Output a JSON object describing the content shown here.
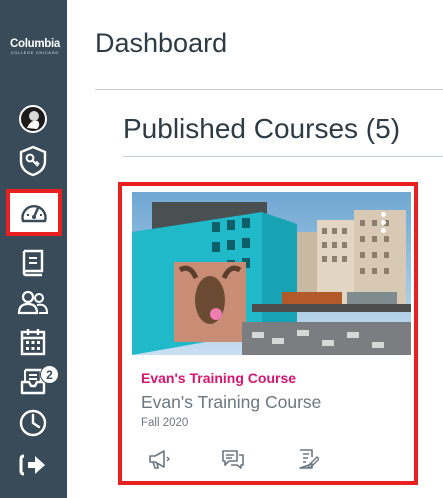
{
  "nav": {
    "brand": {
      "name": "Columbia",
      "subtitle": "COLLEGE CHICAGO"
    },
    "items": [
      {
        "name": "account",
        "icon": "account-avatar-icon"
      },
      {
        "name": "admin",
        "icon": "shield-key-icon"
      },
      {
        "name": "dashboard",
        "icon": "speedometer-icon",
        "active": true
      },
      {
        "name": "courses",
        "icon": "book-icon"
      },
      {
        "name": "groups",
        "icon": "people-icon"
      },
      {
        "name": "calendar",
        "icon": "calendar-icon"
      },
      {
        "name": "inbox",
        "icon": "inbox-icon",
        "badge": "2"
      },
      {
        "name": "history",
        "icon": "clock-icon"
      },
      {
        "name": "logout",
        "icon": "logout-arrow-icon"
      }
    ],
    "active_outline_color": "#e8201f",
    "background_color": "#394b58"
  },
  "header": {
    "title": "Dashboard"
  },
  "section": {
    "title": "Published Courses (5)"
  },
  "course_card": {
    "link_label": "Evan's Training Course",
    "course_name": "Evan's Training Course",
    "term": "Fall 2020",
    "link_color": "#d6156f",
    "image": "mural-building-cityscape",
    "actions": [
      "announcements-icon",
      "discussions-icon",
      "assignments-icon"
    ]
  }
}
